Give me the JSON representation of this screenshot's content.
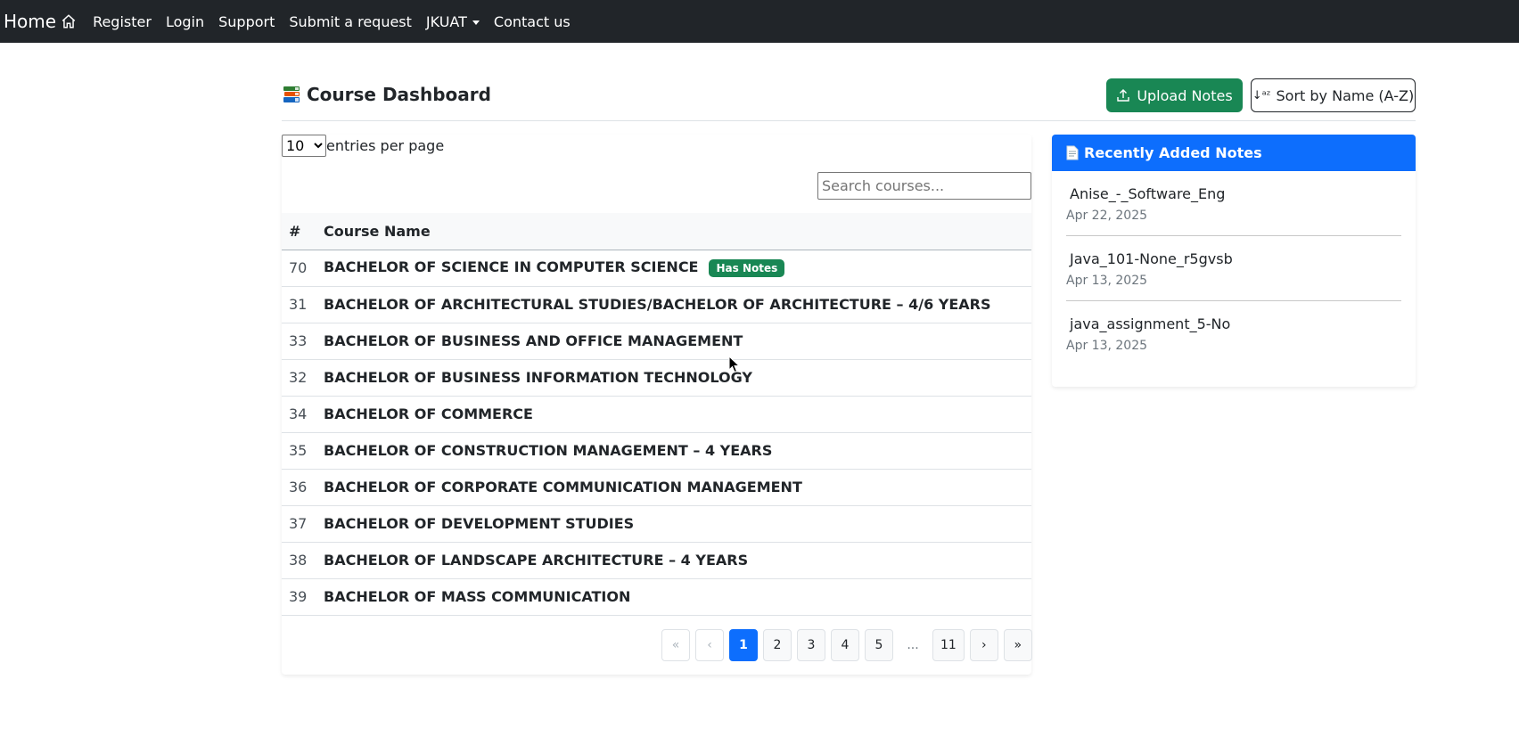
{
  "navbar": {
    "brand": "Home",
    "links": [
      "Register",
      "Login",
      "Support",
      "Submit a request",
      "JKUAT",
      "Contact us"
    ]
  },
  "header": {
    "title": "Course Dashboard",
    "upload_label": "Upload Notes",
    "sort_label": "Sort by Name (A-Z)"
  },
  "table_controls": {
    "entries_value": "10",
    "entries_label": "entries per page",
    "search_placeholder": "Search courses..."
  },
  "table": {
    "headers": [
      "#",
      "Course Name"
    ],
    "rows": [
      {
        "id": "70",
        "name": "BACHELOR OF SCIENCE IN COMPUTER SCIENCE",
        "badge": "Has Notes"
      },
      {
        "id": "31",
        "name": "BACHELOR OF ARCHITECTURAL STUDIES/BACHELOR OF ARCHITECTURE – 4/6 YEARS"
      },
      {
        "id": "33",
        "name": "BACHELOR OF BUSINESS AND OFFICE MANAGEMENT"
      },
      {
        "id": "32",
        "name": "BACHELOR OF BUSINESS INFORMATION TECHNOLOGY"
      },
      {
        "id": "34",
        "name": "BACHELOR OF COMMERCE"
      },
      {
        "id": "35",
        "name": "BACHELOR OF CONSTRUCTION MANAGEMENT – 4 YEARS"
      },
      {
        "id": "36",
        "name": "BACHELOR OF CORPORATE COMMUNICATION MANAGEMENT"
      },
      {
        "id": "37",
        "name": "BACHELOR OF DEVELOPMENT STUDIES"
      },
      {
        "id": "38",
        "name": "BACHELOR OF LANDSCAPE ARCHITECTURE – 4 YEARS"
      },
      {
        "id": "39",
        "name": "BACHELOR OF MASS COMMUNICATION"
      }
    ]
  },
  "pagination": {
    "first": "«",
    "prev": "‹",
    "pages": [
      "1",
      "2",
      "3",
      "4",
      "5"
    ],
    "ellipsis": "...",
    "last_page": "11",
    "next": "›",
    "last": "»",
    "current": "1"
  },
  "recent_notes": {
    "title": "Recently Added Notes",
    "items": [
      {
        "name": "Anise_-_Software_Eng",
        "date": "Apr 22, 2025"
      },
      {
        "name": "Java_101-None_r5gvsb",
        "date": "Apr 13, 2025"
      },
      {
        "name": "java_assignment_5-No",
        "date": "Apr 13, 2025"
      }
    ]
  },
  "colors": {
    "navbar": "#212529",
    "success": "#198754",
    "primary": "#0d6efd"
  }
}
